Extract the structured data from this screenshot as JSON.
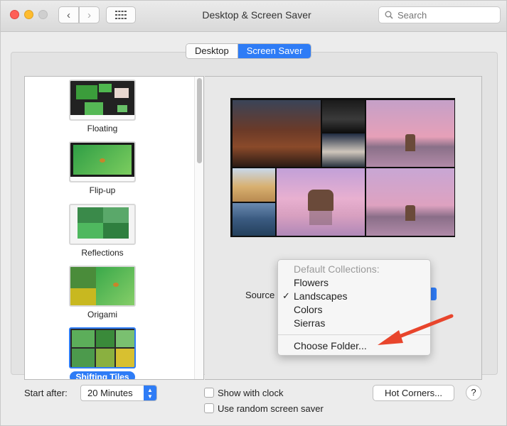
{
  "window": {
    "title": "Desktop & Screen Saver",
    "search_placeholder": "Search"
  },
  "tabs": [
    {
      "label": "Desktop",
      "active": false
    },
    {
      "label": "Screen Saver",
      "active": true
    }
  ],
  "screen_savers": [
    {
      "label": "Floating",
      "selected": false
    },
    {
      "label": "Flip-up",
      "selected": false
    },
    {
      "label": "Reflections",
      "selected": false
    },
    {
      "label": "Origami",
      "selected": false
    },
    {
      "label": "Shifting Tiles",
      "selected": true
    }
  ],
  "options": {
    "source_label": "Source"
  },
  "source_menu": {
    "header": "Default Collections:",
    "items": [
      {
        "label": "Flowers",
        "checked": false
      },
      {
        "label": "Landscapes",
        "checked": true
      },
      {
        "label": "Colors",
        "checked": false
      },
      {
        "label": "Sierras",
        "checked": false
      }
    ],
    "choose_folder": "Choose Folder..."
  },
  "bottom": {
    "start_after_label": "Start after:",
    "start_after_value": "20 Minutes",
    "show_with_clock_label": "Show with clock",
    "show_with_clock_checked": false,
    "random_label": "Use random screen saver",
    "random_checked": false,
    "hot_corners_label": "Hot Corners...",
    "help_label": "?"
  },
  "colors": {
    "accent": "#2e7cf6",
    "annotation_arrow": "#e8452c"
  }
}
